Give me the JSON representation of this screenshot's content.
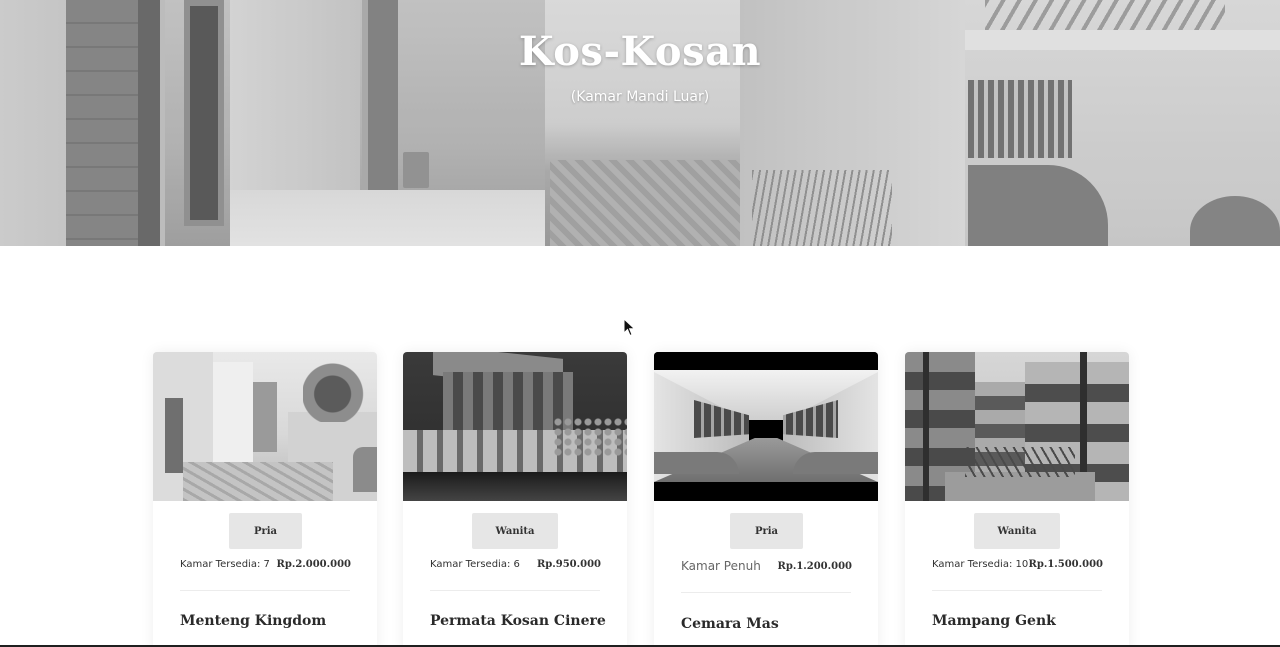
{
  "hero": {
    "title": "Kos-Kosan",
    "subtitle": "(Kamar Mandi Luar)"
  },
  "listings": [
    {
      "gender": "Pria",
      "availability": "Kamar Tersedia: 7",
      "price": "Rp.2.000.000",
      "name": "Menteng Kingdom"
    },
    {
      "gender": "Wanita",
      "availability": "Kamar Tersedia: 6",
      "price": "Rp.950.000",
      "name": "Permata Kosan Cinere"
    },
    {
      "gender": "Pria",
      "availability": "Kamar Penuh",
      "price": "Rp.1.200.000",
      "name": "Cemara Mas"
    },
    {
      "gender": "Wanita",
      "availability": "Kamar Tersedia: 10",
      "price": "Rp.1.500.000",
      "name": "Mampang Genk"
    }
  ]
}
